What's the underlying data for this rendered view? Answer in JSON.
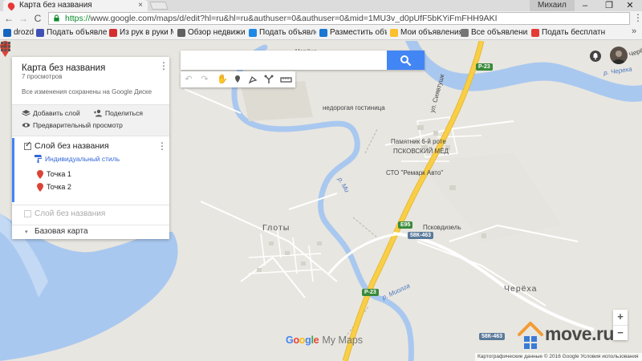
{
  "browser": {
    "tab_title": "Карта без названия",
    "tab_close": "×",
    "user_label": "Михаил",
    "window_buttons": [
      "–",
      "❐",
      "✕"
    ],
    "nav": {
      "back": "←",
      "forward": "→",
      "reload": "C"
    },
    "url_scheme": "https://",
    "url_rest": "www.google.com/maps/d/edit?hl=ru&hl=ru&authuser=0&authuser=0&mid=1MU3v_d0pUfF5bKYiFmFHH9AKI",
    "menu": "⋮",
    "bookmarks": [
      {
        "label": "drozd",
        "icon_color": "#1565c0"
      },
      {
        "label": "Подать объявлени",
        "icon_color": "#3f51b5"
      },
      {
        "label": "Из рук в руки Ме",
        "icon_color": "#d32f2f"
      },
      {
        "label": "Обзор недвижи",
        "icon_color": "#616161"
      },
      {
        "label": "Подать объявлен",
        "icon_color": "#1e88e5"
      },
      {
        "label": "Разместить объ",
        "icon_color": "#1976d2"
      },
      {
        "label": "Мои объявления",
        "icon_color": "#fbc02d"
      },
      {
        "label": "Все объявления",
        "icon_color": "#757575"
      },
      {
        "label": "Подать бесплатн",
        "icon_color": "#e53935"
      }
    ],
    "bookmarks_more": "»"
  },
  "panel": {
    "title": "Карта без названия",
    "views": "7 просмотров",
    "saved_status": "Все изменения сохранены на Google Диске",
    "menu": "⋮",
    "actions": {
      "add_layer": "Добавить слой",
      "share": "Поделиться",
      "preview": "Предварительный просмотр"
    },
    "layer1": {
      "name": "Слой без названия",
      "style": "Индивидуальный стиль",
      "menu": "⋮",
      "points": [
        "Точка 1",
        "Точка 2"
      ]
    },
    "layer2": {
      "name": "Слой без названия"
    },
    "base_map": {
      "name": "Базовая карта",
      "arrow": "▾"
    }
  },
  "search": {
    "value": "",
    "placeholder": ""
  },
  "tools": [
    "↶",
    "↷",
    "✋",
    "pin",
    "line",
    "route",
    "ruler"
  ],
  "map_labels": {
    "village_glotny": "Глоты",
    "village_chereha": "Черёха",
    "river_chereha_top": "р. Череха",
    "river_miolga": "р. Миолга",
    "river_m": "р. Ми",
    "hotel": "недорогая гостиница",
    "monument": "Памятник 6-й роте",
    "pskov_med": "ПСКОВСКИЙ МЁД",
    "sto": "СТО \"Ремарк Авто\"",
    "pskovdizel": "Псковдизель",
    "street": "ул. Сиявтушк",
    "chereha_small": "Черёха",
    "street_top": "ул. Черёхинская"
  },
  "road_shields": {
    "r23_a": "Р-23",
    "r23_b": "Р-23",
    "r23_c": "Р-23",
    "e95": "E95",
    "k463_a": "58К-463",
    "k463_b": "58К-463"
  },
  "zoom": {
    "in": "+",
    "out": "−"
  },
  "brand": {
    "google": "Google",
    "mymaps": "My Maps"
  },
  "attribution": "Картографические данные © 2016 Google   Условия использования",
  "watermark": "move.ru",
  "colors": {
    "water": "#a9c8f0",
    "land": "#e8e6e0",
    "road_major": "#f8cf45",
    "accent": "#4285f4",
    "marker": "#db4437"
  }
}
